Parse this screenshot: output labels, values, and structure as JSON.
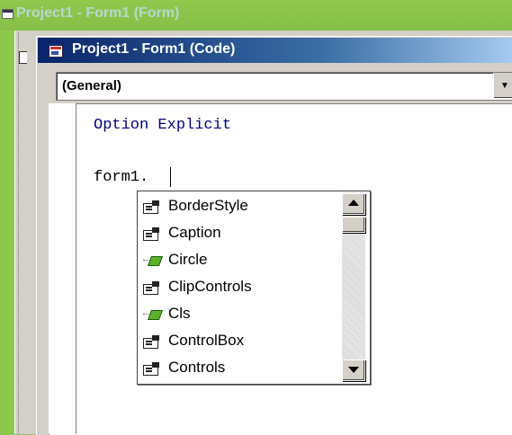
{
  "outer_window": {
    "title": "Project1 - Form1 (Form)"
  },
  "code_window": {
    "title": "Project1 - Form1 (Code)",
    "object_combo": {
      "value": "(General)"
    },
    "code_lines": [
      "Option Explicit",
      "form1."
    ]
  },
  "member_list": {
    "items": [
      {
        "label": "BorderStyle",
        "icon": "property-icon"
      },
      {
        "label": "Caption",
        "icon": "property-icon"
      },
      {
        "label": "Circle",
        "icon": "method-icon"
      },
      {
        "label": "ClipControls",
        "icon": "property-icon"
      },
      {
        "label": "Cls",
        "icon": "method-icon"
      },
      {
        "label": "ControlBox",
        "icon": "property-icon"
      },
      {
        "label": "Controls",
        "icon": "property-icon"
      }
    ]
  },
  "colors": {
    "desktop": "#8cc84b",
    "title_active": "#0a246a",
    "keyword": "#00007f",
    "method_gem": "#59b32a"
  }
}
